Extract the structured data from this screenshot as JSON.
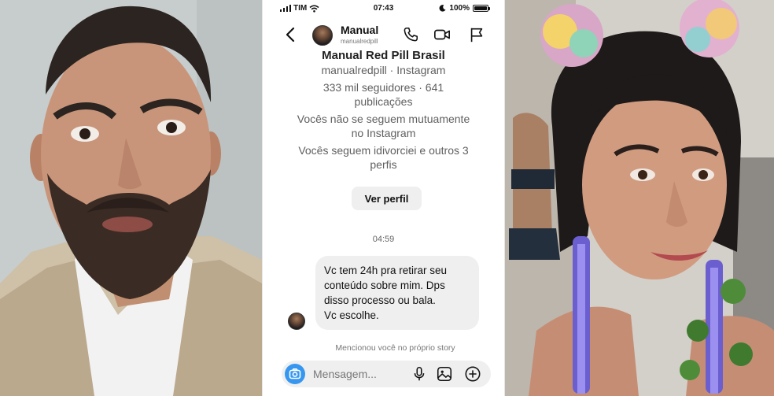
{
  "status_bar": {
    "carrier": "TIM",
    "time": "07:43",
    "battery": "100%",
    "battery_level": 1.0
  },
  "header": {
    "name": "Manual",
    "handle": "manualredpill",
    "icons": [
      "back-icon",
      "call-icon",
      "video-icon",
      "flag-icon"
    ]
  },
  "profile": {
    "name": "Manual Red Pill Brasil",
    "subtitle": "manualredpill · Instagram",
    "stats_line1": "333 mil seguidores · 641",
    "stats_line2": "publicações",
    "mutual_line1": "Vocês não se seguem mutuamente",
    "mutual_line2": "no Instagram",
    "follows_line1": "Vocês seguem idivorciei e outros 3",
    "follows_line2": "perfis",
    "view_profile": "Ver perfil"
  },
  "conversation": {
    "timestamp": "04:59",
    "message_lines": [
      "Vc tem 24h pra retirar seu",
      "conteúdo sobre mim. Dps",
      "disso processo ou bala.",
      "Vc escolhe."
    ],
    "mention_note": "Mencionou você no próprio story"
  },
  "composer": {
    "placeholder": "Mensagem...",
    "icons": [
      "camera-icon",
      "mic-icon",
      "gallery-icon",
      "plus-icon"
    ]
  },
  "colors": {
    "accent": "#3797f0",
    "bubble": "#efefef",
    "text": "#111111",
    "muted": "#5f5f5f"
  }
}
